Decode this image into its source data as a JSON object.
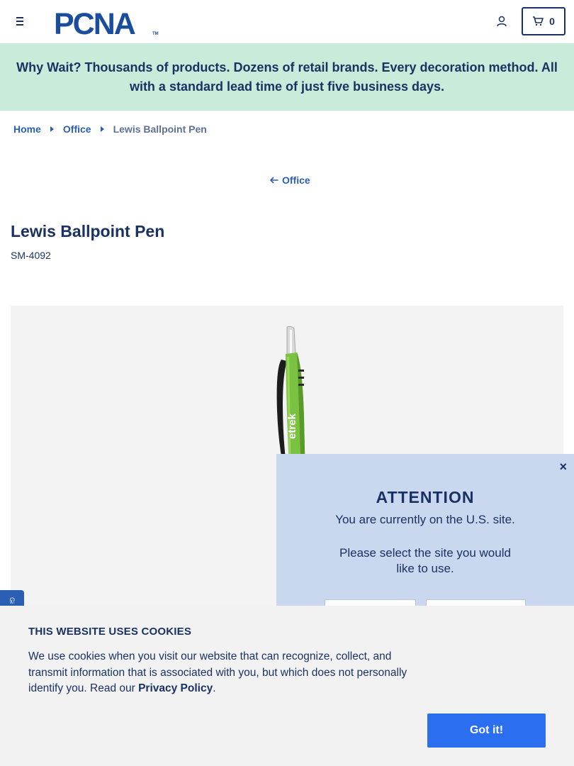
{
  "header": {
    "logo_text": "PCNA",
    "logo_tm": "TM",
    "cart_count": "0"
  },
  "banner": {
    "text": "Why Wait? Thousands of products. Dozens of retail brands. Every decoration method. All with a standard lead time of just five business days."
  },
  "breadcrumb": {
    "items": [
      "Home",
      "Office"
    ],
    "current": "Lewis Ballpoint Pen"
  },
  "back_link": "Office",
  "product": {
    "title": "Lewis Ballpoint Pen",
    "sku": "SM-4092",
    "imprint_text": "etrek"
  },
  "attention": {
    "close": "×",
    "title": "ATTENTION",
    "line1": "You are currently on the U.S. site.",
    "line2": "Please select the site you would like to use."
  },
  "cookies": {
    "title": "THIS WEBSITE USES COOKIES",
    "body": "We use cookies when you visit our website that can recognize, collect, and transmit information that is associated with you, but which does not personally identify you. Read our ",
    "link": "Privacy Policy",
    "period": ".",
    "button": "Got it!"
  },
  "side_tab": "Gi",
  "colors": {
    "navy": "#1a3263",
    "link_blue": "#2b5fb3",
    "banner_green": "#c8ecd9",
    "modal_blue": "#c9d8ef",
    "button_blue": "#2c6ef0",
    "pen_green": "#7cc242"
  }
}
